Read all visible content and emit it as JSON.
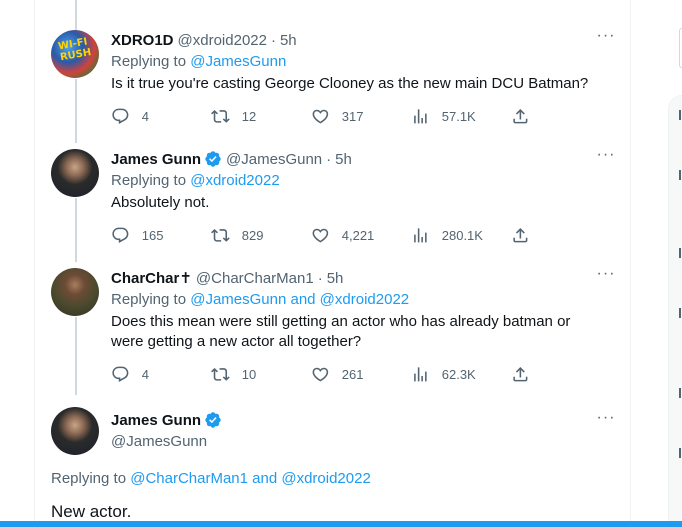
{
  "tweets": [
    {
      "display_name": "XDRO1D",
      "handle": "@xdroid2022",
      "time": "5h",
      "replying_label": "Replying to",
      "replying_to": "@JamesGunn",
      "text": "Is it true you're casting George Clooney as the new main DCU Batman?",
      "replies": "4",
      "retweets": "12",
      "likes": "317",
      "views": "57.1K",
      "avatar_text": "WI-FI RUSH"
    },
    {
      "display_name": "James Gunn",
      "handle": "@JamesGunn",
      "time": "5h",
      "replying_label": "Replying to",
      "replying_to": "@xdroid2022",
      "text": "Absolutely not.",
      "replies": "165",
      "retweets": "829",
      "likes": "4,221",
      "views": "280.1K"
    },
    {
      "display_name": "CharChar✝",
      "handle": "@CharCharMan1",
      "time": "5h",
      "replying_label": "Replying to",
      "replying_to": "@JamesGunn and @xdroid2022",
      "text": "Does this mean were still getting an actor who has already batman or were getting a new actor all together?",
      "replies": "4",
      "retweets": "10",
      "likes": "261",
      "views": "62.3K"
    }
  ],
  "main_tweet": {
    "display_name": "James Gunn",
    "handle": "@JamesGunn",
    "replying_label": "Replying to",
    "replying_to": "@CharCharMan1 and @xdroid2022",
    "text": "New actor."
  },
  "more_label": "···",
  "dot_separator": "·",
  "colors": {
    "accent": "#1d9bf0",
    "text": "#0f1419",
    "secondary": "#536471",
    "verified": "#1d9bf0"
  }
}
